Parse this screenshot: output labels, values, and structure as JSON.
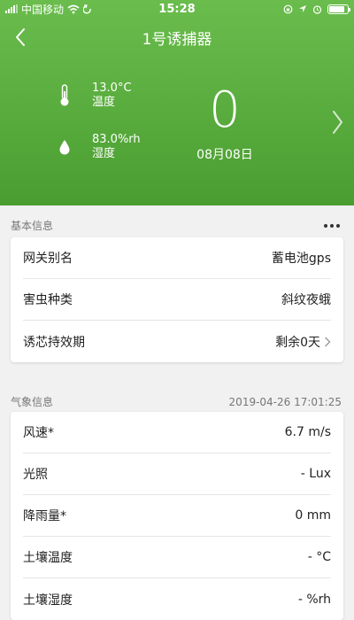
{
  "status_bar": {
    "carrier": "中国移动",
    "time": "15:28"
  },
  "header": {
    "title": "1号诱捕器"
  },
  "environment": {
    "temperature_value": "13.0°C",
    "temperature_label": "温度",
    "humidity_value": "83.0%rh",
    "humidity_label": "湿度",
    "count": "0",
    "date": "08月08日"
  },
  "basic_info": {
    "title": "基本信息",
    "rows": [
      {
        "label": "网关别名",
        "value": "蓄电池gps"
      },
      {
        "label": "害虫种类",
        "value": "斜纹夜蛾"
      },
      {
        "label": "诱芯持效期",
        "value": "剩余0天"
      }
    ]
  },
  "weather": {
    "title": "气象信息",
    "timestamp": "2019-04-26 17:01:25",
    "rows": [
      {
        "label": "风速*",
        "value": "6.7 m/s"
      },
      {
        "label": "光照",
        "value": "- Lux"
      },
      {
        "label": "降雨量*",
        "value": "0 mm"
      },
      {
        "label": "土壤温度",
        "value": "- °C"
      },
      {
        "label": "土壤湿度",
        "value": "- %rh"
      }
    ]
  },
  "colors": {
    "hero_top": "#6abd4d",
    "hero_bottom": "#4a9d30",
    "background": "#f1f1f1"
  },
  "icons": {
    "back": "chevron-left-icon",
    "next": "chevron-right-icon",
    "temperature": "thermometer-icon",
    "humidity": "droplet-icon",
    "more": "ellipsis-icon"
  }
}
